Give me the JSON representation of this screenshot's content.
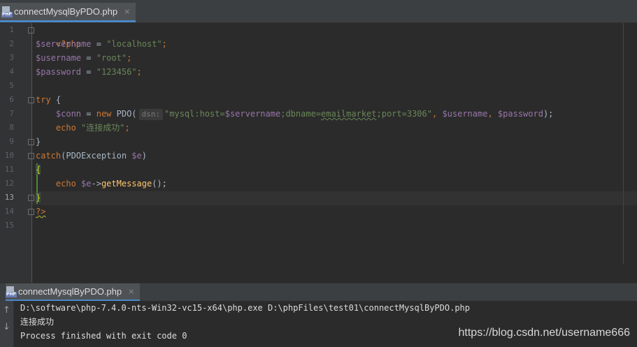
{
  "editor_tab": {
    "label": "connectMysqlByPDO.php",
    "close": "×",
    "icon_text": "PHP"
  },
  "line_numbers": [
    "1",
    "2",
    "3",
    "4",
    "5",
    "6",
    "7",
    "8",
    "9",
    "10",
    "11",
    "12",
    "13",
    "14",
    "15"
  ],
  "code": {
    "l1": {
      "tag": "<?php"
    },
    "l2": {
      "var": "$servername",
      "eq": " = ",
      "str": "\"localhost\"",
      "semi": ";"
    },
    "l3": {
      "var": "$username",
      "eq": " = ",
      "str": "\"root\"",
      "semi": ";"
    },
    "l4": {
      "var": "$password",
      "eq": " = ",
      "str": "\"123456\"",
      "semi": ";"
    },
    "l6": {
      "kw": "try",
      "rest": " {"
    },
    "l7": {
      "indent": "    ",
      "var": "$conn",
      "eq": " = ",
      "kw": "new",
      "cls": " PDO(",
      "hint": "dsn:",
      "str_a": "\"mysql:host=",
      "str_var": "$servername",
      "str_b": ";dbname=",
      "str_typo": "emailmarket",
      "str_c": ";port=3306\"",
      "comma1": ", ",
      "var2": "$username",
      "comma2": ", ",
      "var3": "$password",
      "end": ");"
    },
    "l8": {
      "indent": "    ",
      "kw": "echo",
      "sp": " ",
      "str": "\"连接成功\"",
      "semi": ";"
    },
    "l9": {
      "text": "}"
    },
    "l10": {
      "kw": "catch",
      "open": "(PDOException ",
      "var": "$e",
      "close": ")"
    },
    "l11": {
      "text": "{"
    },
    "l12": {
      "indent": "    ",
      "kw": "echo",
      "sp": " ",
      "var": "$e",
      "arrow": "->",
      "fn": "getMessage",
      "end": "();"
    },
    "l13": {
      "text": "}"
    },
    "l14": {
      "tag": "?>"
    }
  },
  "run_panel": {
    "tab_label": "connectMysqlByPDO.php",
    "close": "×",
    "icon_text": "PHP",
    "arrow_up": "↑",
    "arrow_down": "↓",
    "lines": [
      "D:\\software\\php-7.4.0-nts-Win32-vc15-x64\\php.exe D:\\phpFiles\\test01\\connectMysqlByPDO.php",
      "连接成功",
      "Process finished with exit code 0"
    ]
  },
  "watermark": "https://blog.csdn.net/username666",
  "colors": {
    "keyword": "#cc7832",
    "variable": "#9876aa",
    "string": "#6a8759",
    "function": "#ffc66d",
    "text": "#a9b7c6",
    "background": "#2b2b2b"
  }
}
